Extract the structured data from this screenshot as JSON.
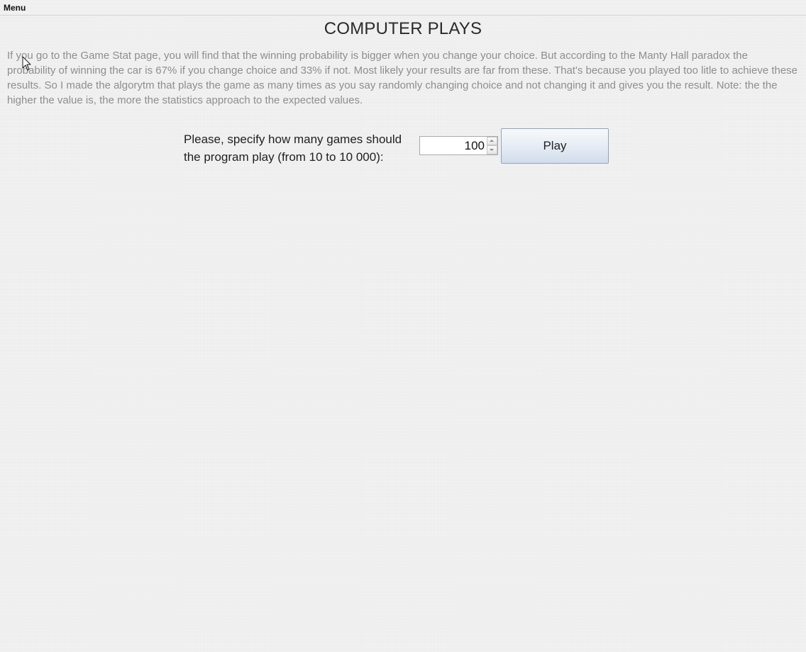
{
  "menubar": {
    "menu_label": "Menu"
  },
  "main": {
    "title": "COMPUTER PLAYS",
    "intro_text": "If you go to the Game Stat page, you will find that the winning probability is bigger when you change your choice. But according to the Manty Hall paradox the probability of winning the car is 67% if you change choice and 33% if not. Most likely your results are far from these. That's because you played too litle to achieve these results. So I made the algorytm that plays the game as many times as you say randomly changing choice and not changing it and gives you the result. Note: the the higher the value is, the more the statistics approach to the expected values.",
    "games_label": "Please, specify how many games should the program play (from 10 to 10 000):",
    "games_value": "100",
    "play_button_label": "Play"
  },
  "icons": {
    "spin_up": "chevron-up-icon",
    "spin_down": "chevron-down-icon",
    "cursor": "mouse-pointer-icon"
  },
  "colors": {
    "background": "#efefef",
    "intro_text": "#8e8e8e",
    "title_text": "#2a2a2a",
    "button_border": "#8fa6be"
  }
}
